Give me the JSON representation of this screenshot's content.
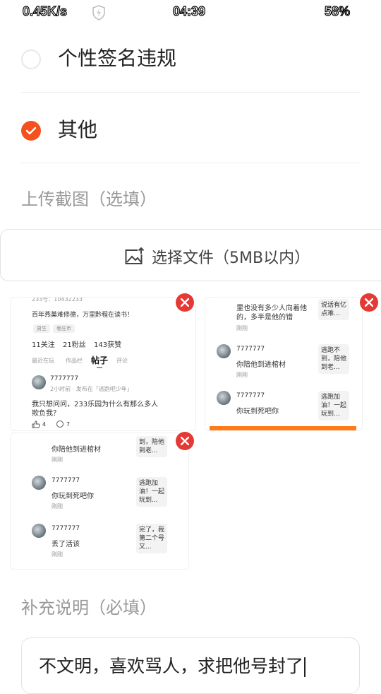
{
  "status_bar": {
    "speed": "0.45K/s",
    "time": "04:39",
    "battery": "58%"
  },
  "options": [
    {
      "label": "个性签名违规",
      "checked": false
    },
    {
      "label": "其他",
      "checked": true
    }
  ],
  "upload": {
    "section_label": "上传截图（选填）",
    "button_label": "选择文件（5MB以内）"
  },
  "screenshots": {
    "shot1": {
      "header_partial": "233号：10432233",
      "bio": "百年燕巢难修德，万里黔程在读书！",
      "tags": [
        "男生",
        "枣庄市"
      ],
      "follow": "11关注",
      "fans": "21粉丝",
      "likes": "143获赞",
      "tabs": [
        "最近在玩",
        "作品栏",
        "帖子",
        "评论"
      ],
      "user": "7777777",
      "meta": "2小时前 · 发布在「逃跑吧少年」",
      "post_text_1": "我只想问问，233乐园为什么有那么多人",
      "post_text_2": "欺负我？",
      "like_count": "4",
      "comment_count": "7"
    },
    "shot2": {
      "top_line_1": "里也没有多少人向着他",
      "top_line_2": "的，多半是他的错",
      "top_bubble": "说话有亿点难...",
      "item1_user": "7777777",
      "item1_text": "你陪他到进棺材",
      "item1_bubble": "逃跑不到，陪他到老...",
      "item2_user": "7777777",
      "item2_text": "你玩到死吧你",
      "item2_bubble": "逃跑加油！一起玩到...",
      "meta": "刚刚"
    },
    "shot3": {
      "item0_text": "你陪他到进棺材",
      "item0_bubble": "到，陪他到老...",
      "item1_user": "7777777",
      "item1_text": "你玩到死吧你",
      "item1_bubble": "逃跑加油！一起玩到...",
      "item2_user": "7777777",
      "item2_text": "丢了活该",
      "item2_bubble": "完了，我第二个号又...",
      "meta": "刚刚"
    }
  },
  "supplement": {
    "label": "补充说明（必填）",
    "value": "不文明，喜欢骂人，求把他号封了"
  },
  "colors": {
    "accent": "#f4511e",
    "delete": "#e53935",
    "divider": "#ececec"
  },
  "icons": [
    "shield-icon",
    "check-icon",
    "image-upload-icon",
    "close-icon",
    "avatar",
    "thumb-up-icon",
    "comment-icon"
  ]
}
